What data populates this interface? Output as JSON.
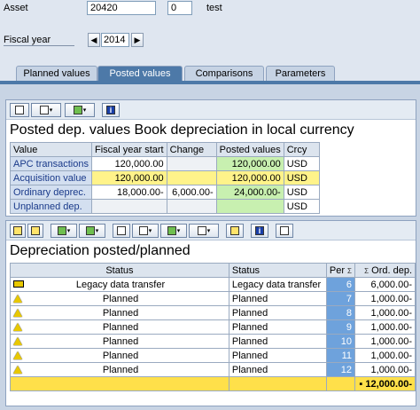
{
  "header": {
    "asset_label": "Asset",
    "asset_value": "20420",
    "subnumber_value": "0",
    "asset_desc": "test",
    "fiscal_year_label": "Fiscal year",
    "fiscal_year_value": "2014",
    "prev_arrow": "◀",
    "next_arrow": "▶"
  },
  "tabs": [
    {
      "label": "Planned values",
      "active": false
    },
    {
      "label": "Posted values",
      "active": true
    },
    {
      "label": "Comparisons",
      "active": false
    },
    {
      "label": "Parameters",
      "active": false
    }
  ],
  "section1": {
    "title": "Posted dep. values Book depreciation in local currency",
    "columns": [
      "Value",
      "Fiscal year start",
      "Change",
      "Posted values",
      "Crcy"
    ],
    "rows": [
      {
        "value": "APC transactions",
        "fy_start": "120,000.00",
        "change": "",
        "posted": "120,000.00",
        "crcy": "USD"
      },
      {
        "value": "Acquisition value",
        "fy_start": "120,000.00",
        "change": "",
        "posted": "120,000.00",
        "crcy": "USD"
      },
      {
        "value": "Ordinary deprec.",
        "fy_start": "18,000.00-",
        "change": "6,000.00-",
        "posted": "24,000.00-",
        "crcy": "USD"
      },
      {
        "value": "Unplanned dep.",
        "fy_start": "",
        "change": "",
        "posted": "",
        "crcy": "USD"
      }
    ]
  },
  "section2": {
    "title": "Depreciation posted/planned",
    "columns": [
      "Status",
      "Status",
      "Per",
      "Ord. dep."
    ],
    "sum_marker": "Σ",
    "rows": [
      {
        "icon": "legacy",
        "status1": "Legacy data transfer",
        "status2": "Legacy data transfer",
        "per": "6",
        "ord": "6,000.00-"
      },
      {
        "icon": "planned",
        "status1": "Planned",
        "status2": "Planned",
        "per": "7",
        "ord": "1,000.00-"
      },
      {
        "icon": "planned",
        "status1": "Planned",
        "status2": "Planned",
        "per": "8",
        "ord": "1,000.00-"
      },
      {
        "icon": "planned",
        "status1": "Planned",
        "status2": "Planned",
        "per": "9",
        "ord": "1,000.00-"
      },
      {
        "icon": "planned",
        "status1": "Planned",
        "status2": "Planned",
        "per": "10",
        "ord": "1,000.00-"
      },
      {
        "icon": "planned",
        "status1": "Planned",
        "status2": "Planned",
        "per": "11",
        "ord": "1,000.00-"
      },
      {
        "icon": "planned",
        "status1": "Planned",
        "status2": "Planned",
        "per": "12",
        "ord": "1,000.00-"
      }
    ],
    "total_marker": "▪",
    "total": "12,000.00-"
  },
  "colors": {
    "tab_active": "#4d79a8",
    "total_row": "#ffe04a",
    "per_cell": "#6ea2dc"
  }
}
